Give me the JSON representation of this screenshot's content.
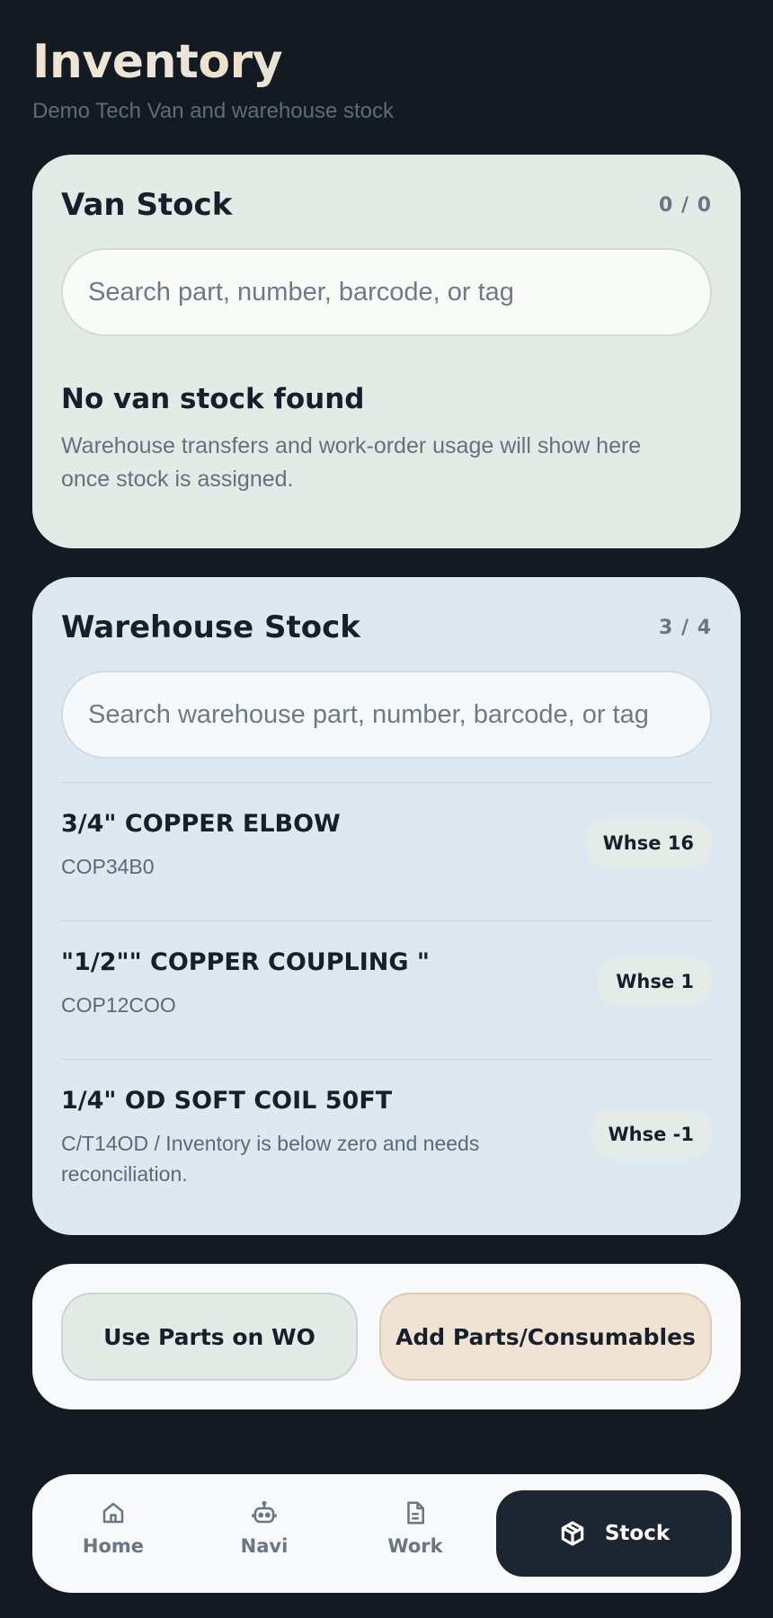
{
  "header": {
    "title": "Inventory",
    "subtitle": "Demo Tech Van and warehouse stock"
  },
  "van_stock": {
    "title": "Van Stock",
    "count": "0 / 0",
    "search_placeholder": "Search part, number, barcode, or tag",
    "empty_title": "No van stock found",
    "empty_text": "Warehouse transfers and work-order usage will show here once stock is assigned."
  },
  "warehouse_stock": {
    "title": "Warehouse Stock",
    "count": "3 / 4",
    "search_placeholder": "Search warehouse part, number, barcode, or tag",
    "items": [
      {
        "name": "3/4\" COPPER ELBOW",
        "sub": "COP34B0",
        "badge": "Whse 16"
      },
      {
        "name": "\"1/2\"\" COPPER COUPLING \"",
        "sub": "COP12COO",
        "badge": "Whse 1"
      },
      {
        "name": "1/4\" OD SOFT COIL 50FT",
        "sub": "C/T14OD / Inventory is below zero and needs reconciliation.",
        "badge": "Whse -1"
      }
    ]
  },
  "actions": {
    "use_parts_label": "Use Parts on WO",
    "add_parts_label": "Add Parts/Consumables"
  },
  "nav": {
    "items": [
      {
        "label": "Home",
        "icon": "home-icon"
      },
      {
        "label": "Navi",
        "icon": "robot-icon"
      },
      {
        "label": "Work",
        "icon": "document-icon"
      },
      {
        "label": "Stock",
        "icon": "box-icon",
        "active": true
      }
    ]
  },
  "colors": {
    "background": "#131a22",
    "van_card": "#e4ebe6",
    "warehouse_card": "#dde8f0",
    "add_button": "#f1e3d3",
    "nav_active": "#1c2632"
  }
}
